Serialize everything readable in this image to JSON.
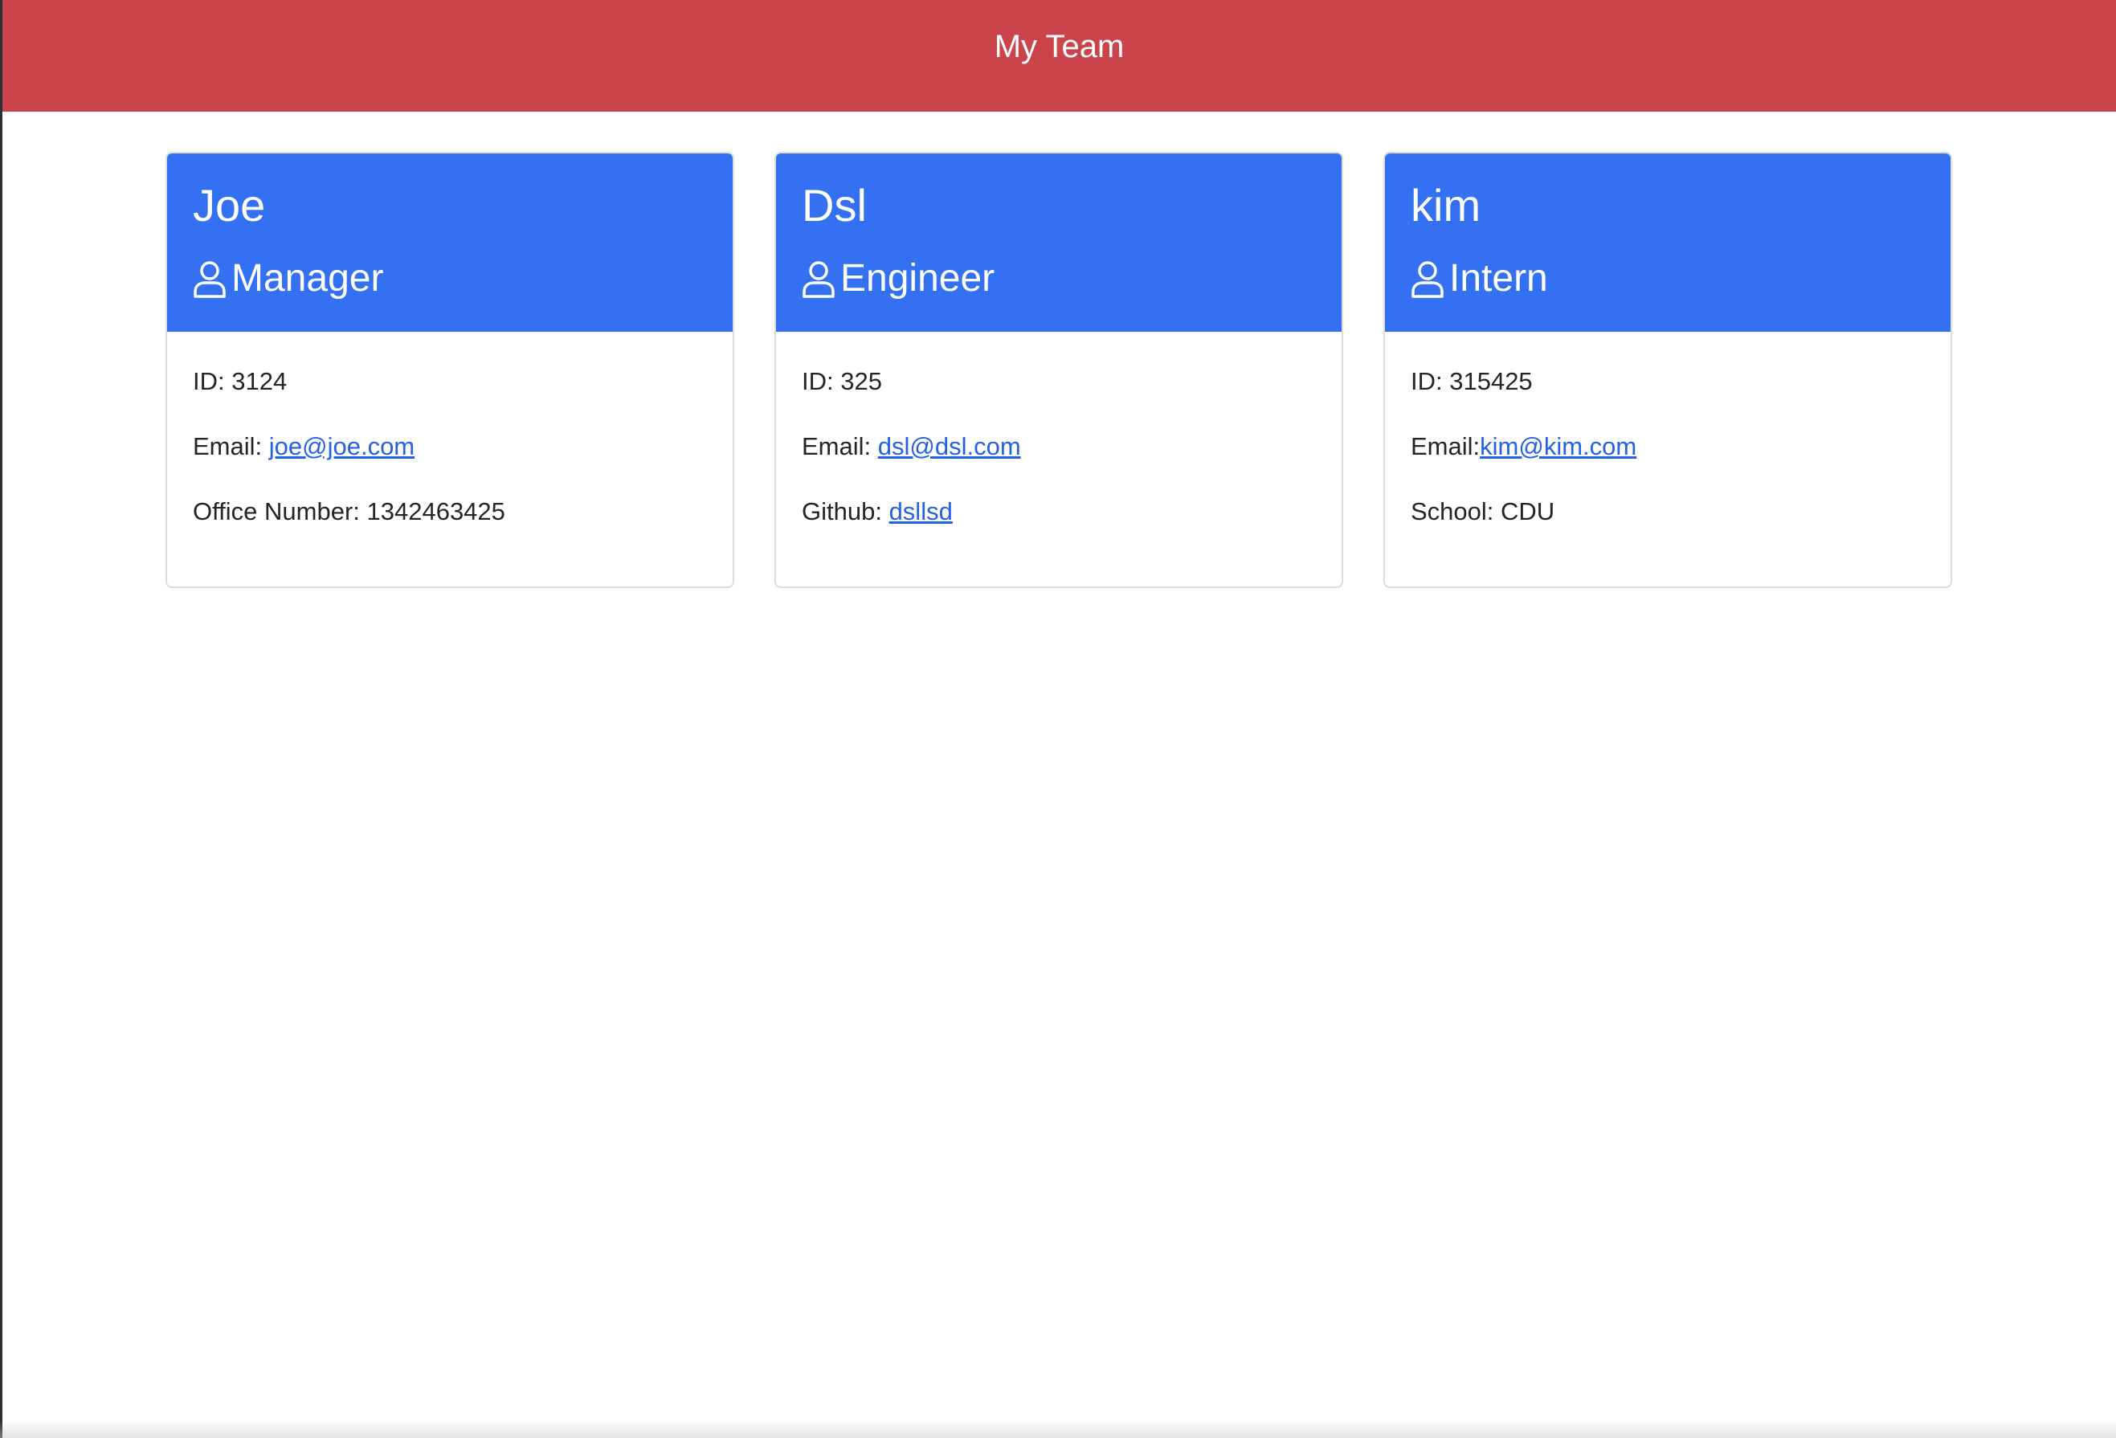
{
  "navbar": {
    "title": "My Team",
    "color": "#cc444b"
  },
  "card_header_color": "#3470f2",
  "link_color": "#2361e6",
  "employees": [
    {
      "name": "Joe",
      "role": "Manager",
      "role_icon": "person-icon",
      "id_line": "ID: 3124",
      "email_label": "Email: ",
      "email": "joe@joe.com",
      "extra_label": "Office Number: 1342463425",
      "extra_link": ""
    },
    {
      "name": "Dsl",
      "role": "Engineer",
      "role_icon": "person-icon",
      "id_line": "ID: 325",
      "email_label": "Email: ",
      "email": "dsl@dsl.com",
      "extra_label": "Github: ",
      "extra_link": "dsllsd"
    },
    {
      "name": "kim",
      "role": "Intern",
      "role_icon": "person-icon",
      "id_line": "ID: 315425",
      "email_label": "Email:",
      "email": "kim@kim.com",
      "extra_label": "School: CDU",
      "extra_link": ""
    }
  ]
}
